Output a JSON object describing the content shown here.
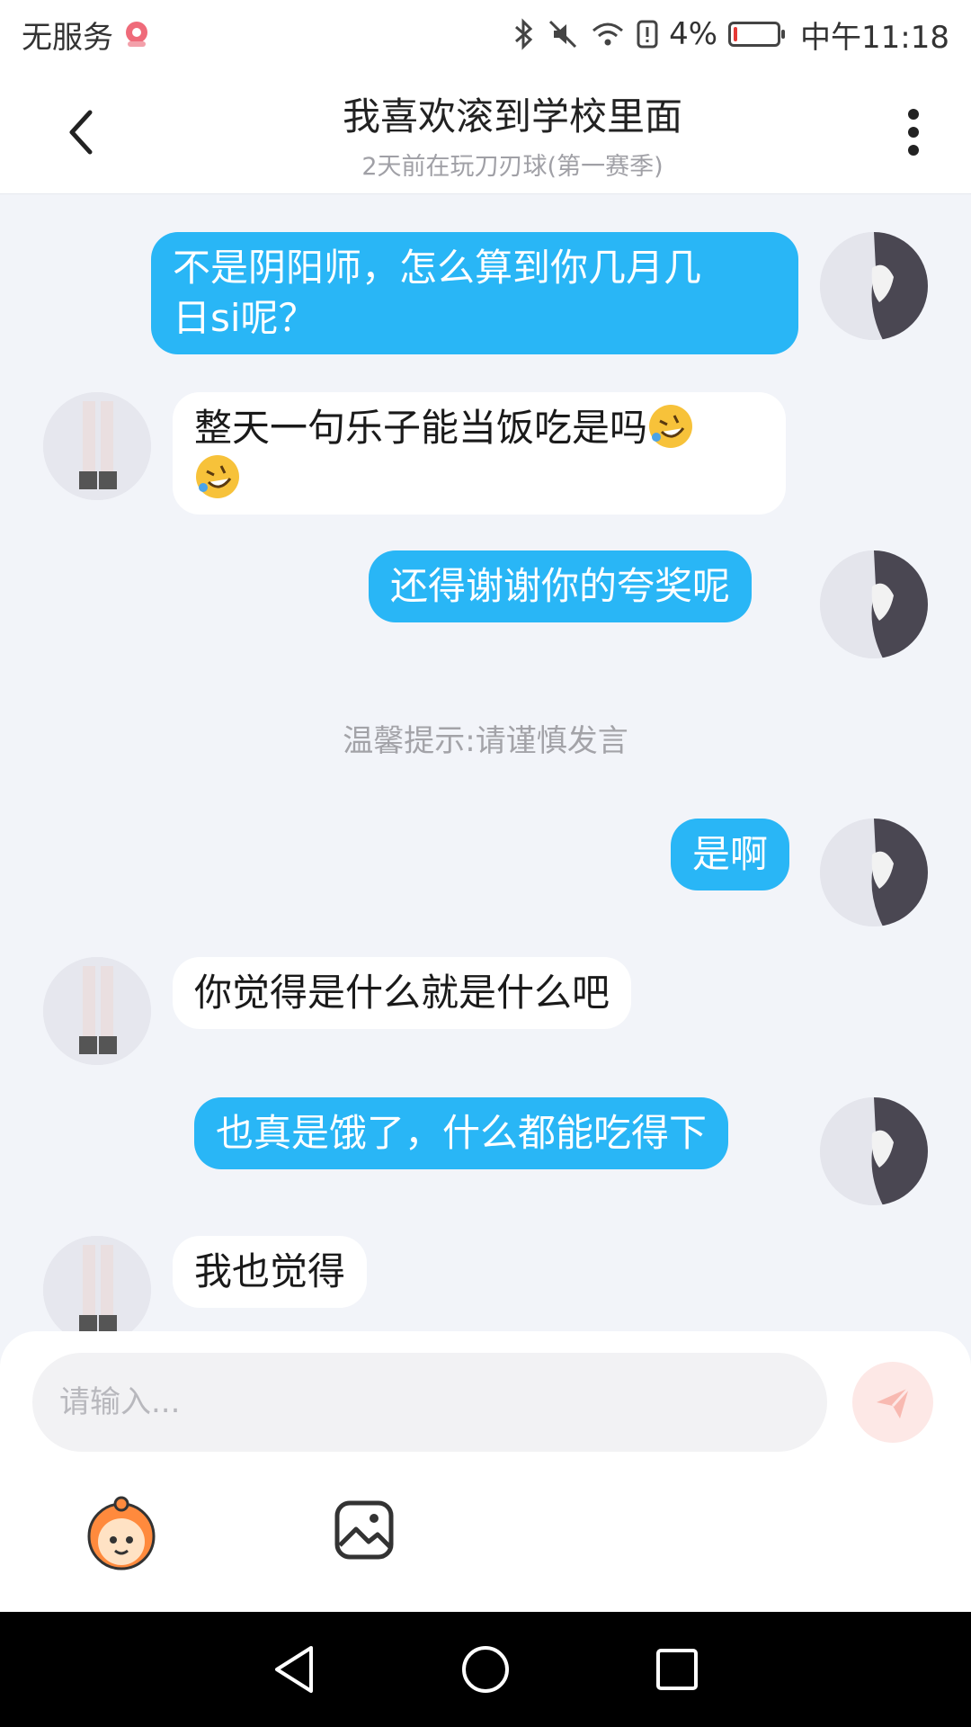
{
  "status_bar": {
    "carrier": "无服务",
    "battery": "4%",
    "battery_level": 0.04,
    "time": "中午11:18",
    "icons": [
      "bluetooth-icon",
      "mute-icon",
      "wifi-icon",
      "alert-icon",
      "battery-icon"
    ]
  },
  "header": {
    "title": "我喜欢滚到学校里面",
    "subtitle": "2天前在玩刀刃球(第一赛季)",
    "back_icon": "chevron-left-icon",
    "more_icon": "more-vertical-icon"
  },
  "messages": [
    {
      "sender": "me",
      "text": "不是阴阳师，怎么算到你几月几",
      "text2": "日si呢？"
    },
    {
      "sender": "other",
      "text": "整天一句乐子能当饭吃是吗",
      "emoji": "rolling-laugh-emoji"
    },
    {
      "sender": "me",
      "text": "还得谢谢你的夸奖呢"
    },
    {
      "sender": "me",
      "text": "是啊"
    },
    {
      "sender": "other",
      "text": "你觉得是什么就是什么吧"
    },
    {
      "sender": "me",
      "text": "也真是饿了，什么都能吃得下"
    },
    {
      "sender": "other",
      "text": "我也觉得"
    }
  ],
  "hint": "温馨提示:请谨慎发言",
  "input": {
    "placeholder": "请输入...",
    "send_icon": "send-icon",
    "sticker_icon": "sticker-face-icon",
    "image_icon": "image-icon"
  },
  "colors": {
    "accent": "#29b6f6",
    "background": "#f2f4f9",
    "send_button": "#fde8e6"
  }
}
